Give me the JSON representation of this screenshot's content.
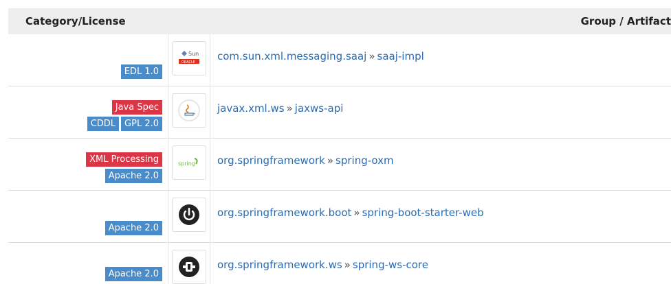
{
  "header": {
    "category_label": "Category/License",
    "group_artifact_label": "Group / Artifact"
  },
  "rows": [
    {
      "badges_red": [],
      "badges_blue": [
        "EDL 1.0"
      ],
      "logo": "sun-oracle-logo",
      "group": "com.sun.xml.messaging.saaj",
      "separator": "»",
      "artifact": "saaj-impl"
    },
    {
      "badges_red": [
        "Java Spec"
      ],
      "badges_blue": [
        "CDDL",
        "GPL 2.0"
      ],
      "logo": "java-logo",
      "group": "javax.xml.ws",
      "separator": "»",
      "artifact": "jaxws-api"
    },
    {
      "badges_red": [
        "XML Processing"
      ],
      "badges_blue": [
        "Apache 2.0"
      ],
      "logo": "spring-logo",
      "group": "org.springframework",
      "separator": "»",
      "artifact": "spring-oxm"
    },
    {
      "badges_red": [],
      "badges_blue": [
        "Apache 2.0"
      ],
      "logo": "spring-boot-power-logo",
      "group": "org.springframework.boot",
      "separator": "»",
      "artifact": "spring-boot-starter-web"
    },
    {
      "badges_red": [],
      "badges_blue": [
        "Apache 2.0"
      ],
      "logo": "spring-ws-logo",
      "group": "org.springframework.ws",
      "separator": "»",
      "artifact": "spring-ws-core"
    }
  ],
  "logo_text": {
    "sun": "Sun",
    "oracle": "ORACLE",
    "spring": "spring"
  },
  "colors": {
    "license_badge": "#4a8bc9",
    "category_badge": "#dc3545",
    "link": "#2a6ab0",
    "header_bg": "#eeeeee"
  }
}
